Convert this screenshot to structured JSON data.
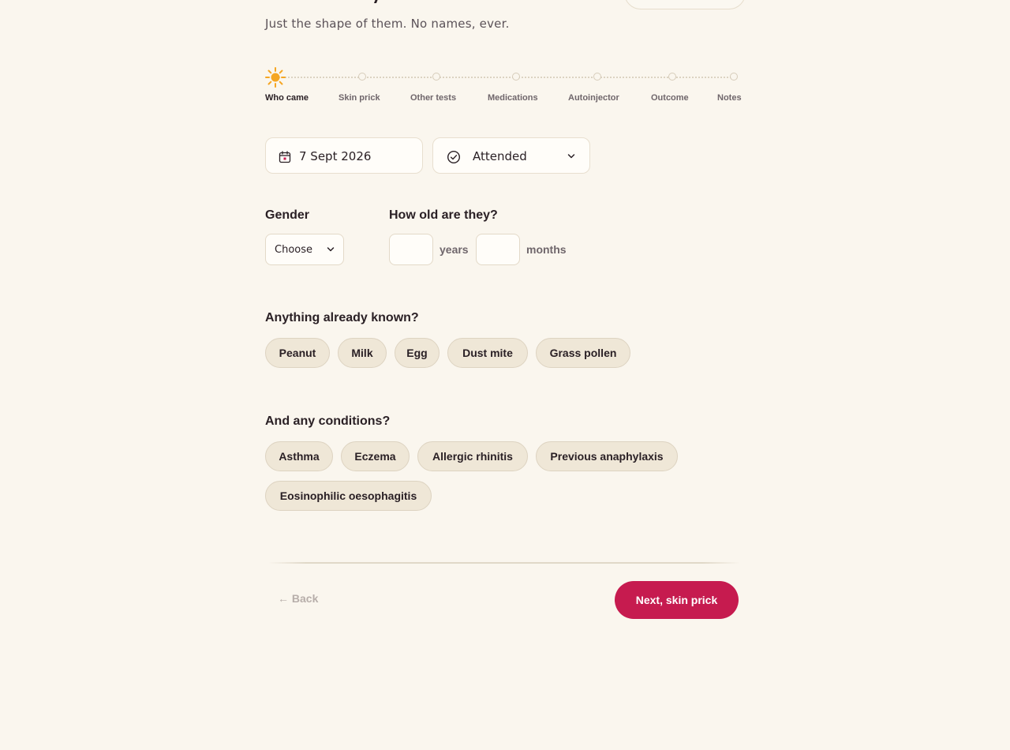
{
  "header": {
    "subtitle": "Just the shape of them. No names, ever."
  },
  "stepper": {
    "steps": [
      {
        "label": "Who came",
        "active": true
      },
      {
        "label": "Skin prick",
        "active": false
      },
      {
        "label": "Other tests",
        "active": false
      },
      {
        "label": "Medications",
        "active": false
      },
      {
        "label": "Autoinjector",
        "active": false
      },
      {
        "label": "Outcome",
        "active": false
      },
      {
        "label": "Notes",
        "active": false
      }
    ],
    "active_icon": "sun-icon"
  },
  "visit": {
    "date_value": "7 Sept 2026",
    "date_icon": "calendar-icon",
    "status_value": "Attended",
    "status_icon": "check-circle-icon"
  },
  "gender": {
    "label": "Gender",
    "selected": "Choose"
  },
  "age": {
    "label": "How old are they?",
    "years_value": "",
    "years_unit": "years",
    "months_value": "",
    "months_unit": "months"
  },
  "known": {
    "label": "Anything already known?",
    "chips": [
      "Peanut",
      "Milk",
      "Egg",
      "Dust mite",
      "Grass pollen"
    ]
  },
  "conditions": {
    "label": "And any conditions?",
    "chips": [
      "Asthma",
      "Eczema",
      "Allergic rhinitis",
      "Previous anaphylaxis",
      "Eosinophilic oesophagitis"
    ]
  },
  "footer": {
    "back_label": "← Back",
    "next_label": "Next, skin prick"
  },
  "colors": {
    "background": "#faf6ee",
    "accent": "#c61b4f",
    "chip_bg": "#efe7d7",
    "sun": "#f5a623"
  }
}
